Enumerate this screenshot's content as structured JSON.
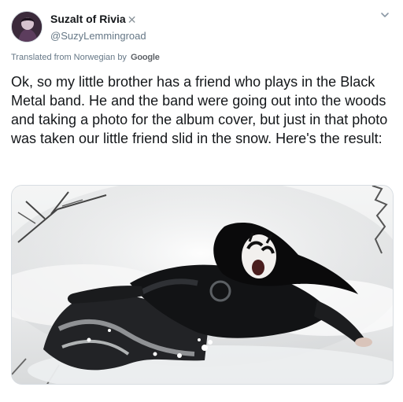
{
  "author": {
    "display_name": "Suzalt of Rivia",
    "handle": "@SuzyLemmingroad",
    "name_emoji_icon": "crossed-swords-icon"
  },
  "translation": {
    "label": "Translated from Norwegian by",
    "provider": "Google"
  },
  "tweet": {
    "text": "Ok, so my little brother has a friend who plays in the Black Metal band. He and the band were going out into the woods and taking a photo for the album cover, but just in that photo was taken our little friend slid in the snow. Here's the result:"
  },
  "media": {
    "photo_icon": "photo-image",
    "subject": "person in corpse paint lying in snow"
  },
  "colors": {
    "text": "#14171a",
    "secondary": "#657786",
    "border": "#d8dde2"
  }
}
